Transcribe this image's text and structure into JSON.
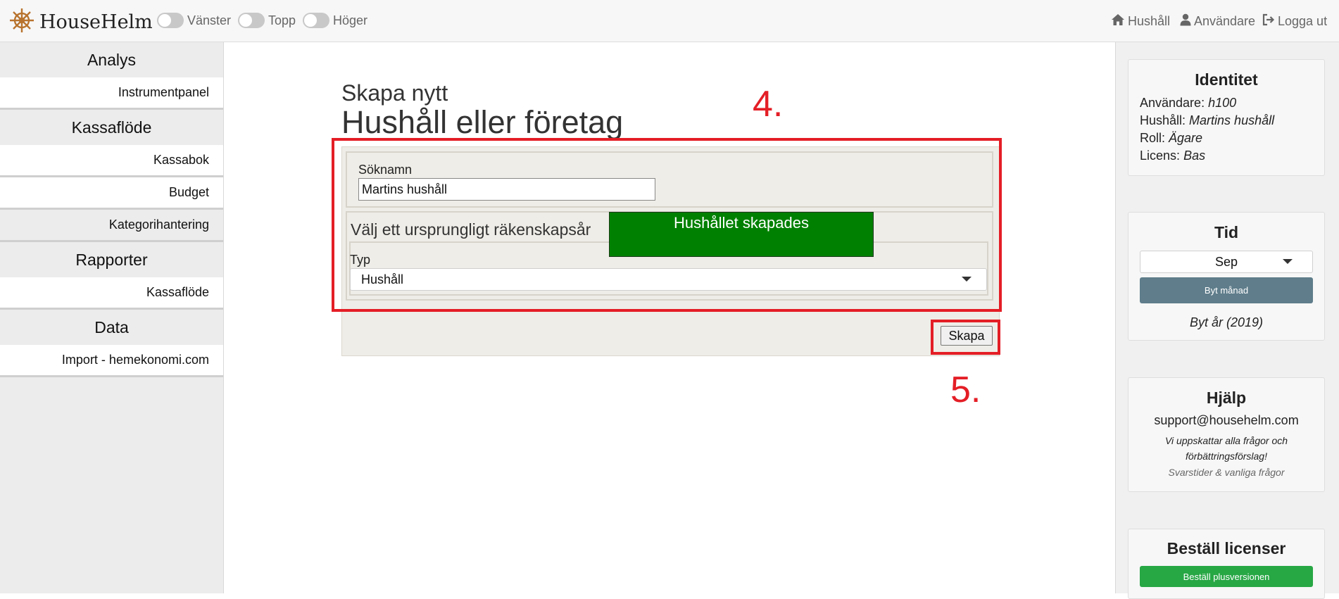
{
  "app": {
    "name": "HouseHelm"
  },
  "toggles": [
    {
      "label": "Vänster",
      "on": false
    },
    {
      "label": "Topp",
      "on": false
    },
    {
      "label": "Höger",
      "on": false
    }
  ],
  "topnav": {
    "household": "Hushåll",
    "users": "Användare",
    "logout": "Logga ut"
  },
  "sidebar": {
    "sections": [
      {
        "title": "Analys",
        "items": [
          "Instrumentpanel"
        ]
      },
      {
        "title": "Kassaflöde",
        "items": [
          "Kassabok",
          "Budget",
          "Kategorihantering"
        ]
      },
      {
        "title": "Rapporter",
        "items": [
          "Kassaflöde"
        ]
      },
      {
        "title": "Data",
        "items": [
          "Import - hemekonomi.com"
        ]
      }
    ]
  },
  "main": {
    "subtitle": "Skapa nytt",
    "title": "Hushåll eller företag",
    "search_name_label": "Söknamn",
    "search_name_value": "Martins hushåll",
    "fiscal_year_legend": "Välj ett ursprungligt räkenskapsår",
    "type_label": "Typ",
    "type_value": "Hushåll",
    "create_button": "Skapa",
    "toast": "Hushållet skapades"
  },
  "annotations": {
    "step4": "4.",
    "step5": "5."
  },
  "identity": {
    "title": "Identitet",
    "user_label": "Användare:",
    "user_value": "h100",
    "household_label": "Hushåll:",
    "household_value": "Martins hushåll",
    "role_label": "Roll:",
    "role_value": "Ägare",
    "license_label": "Licens:",
    "license_value": "Bas"
  },
  "time": {
    "title": "Tid",
    "month": "Sep",
    "change_month_button": "Byt månad",
    "change_year": "Byt år (2019)"
  },
  "help": {
    "title": "Hjälp",
    "email": "support@househelm.com",
    "note_line1": "Vi uppskattar alla frågor och",
    "note_line2": "förbättringsförslag!",
    "faq_link": "Svarstider & vanliga frågor"
  },
  "licenses": {
    "title": "Beställ licenser",
    "order_button": "Beställ plusversionen"
  },
  "colors": {
    "toast_bg": "#008000",
    "annotation_red": "#e41e26",
    "month_button": "#5f7d8b",
    "order_button": "#28a745"
  }
}
